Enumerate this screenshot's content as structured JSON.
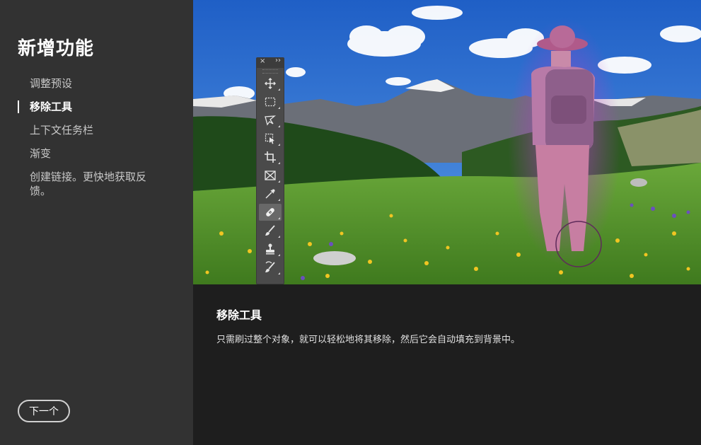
{
  "sidebar": {
    "title": "新增功能",
    "items": [
      {
        "label": "调整预设",
        "active": false
      },
      {
        "label": "移除工具",
        "active": true
      },
      {
        "label": "上下文任务栏",
        "active": false
      },
      {
        "label": "渐变",
        "active": false
      },
      {
        "label": "创建链接。更快地获取反馈。",
        "active": false
      }
    ],
    "next_button": "下一个"
  },
  "toolbar": {
    "close_glyph": "×",
    "collapse_glyph": "››",
    "tools": [
      {
        "icon": "move-icon"
      },
      {
        "icon": "marquee-icon"
      },
      {
        "icon": "lasso-icon"
      },
      {
        "icon": "object-select-icon"
      },
      {
        "icon": "crop-icon"
      },
      {
        "icon": "frame-icon"
      },
      {
        "icon": "eyedropper-icon"
      },
      {
        "icon": "healing-bandage-icon",
        "active": true
      },
      {
        "icon": "brush-icon"
      },
      {
        "icon": "clone-stamp-icon"
      },
      {
        "icon": "history-brush-icon"
      }
    ]
  },
  "caption": {
    "title": "移除工具",
    "description": "只需刷过整个对象，就可以轻松地将其移除，然后它会自动填充到背景中。"
  },
  "colors": {
    "sidebar_bg": "#323232",
    "main_bg": "#1e1e1e",
    "sky": "#2f6fd0",
    "meadow": "#5a9a2e",
    "selection_overlay": "#c23fb4"
  }
}
